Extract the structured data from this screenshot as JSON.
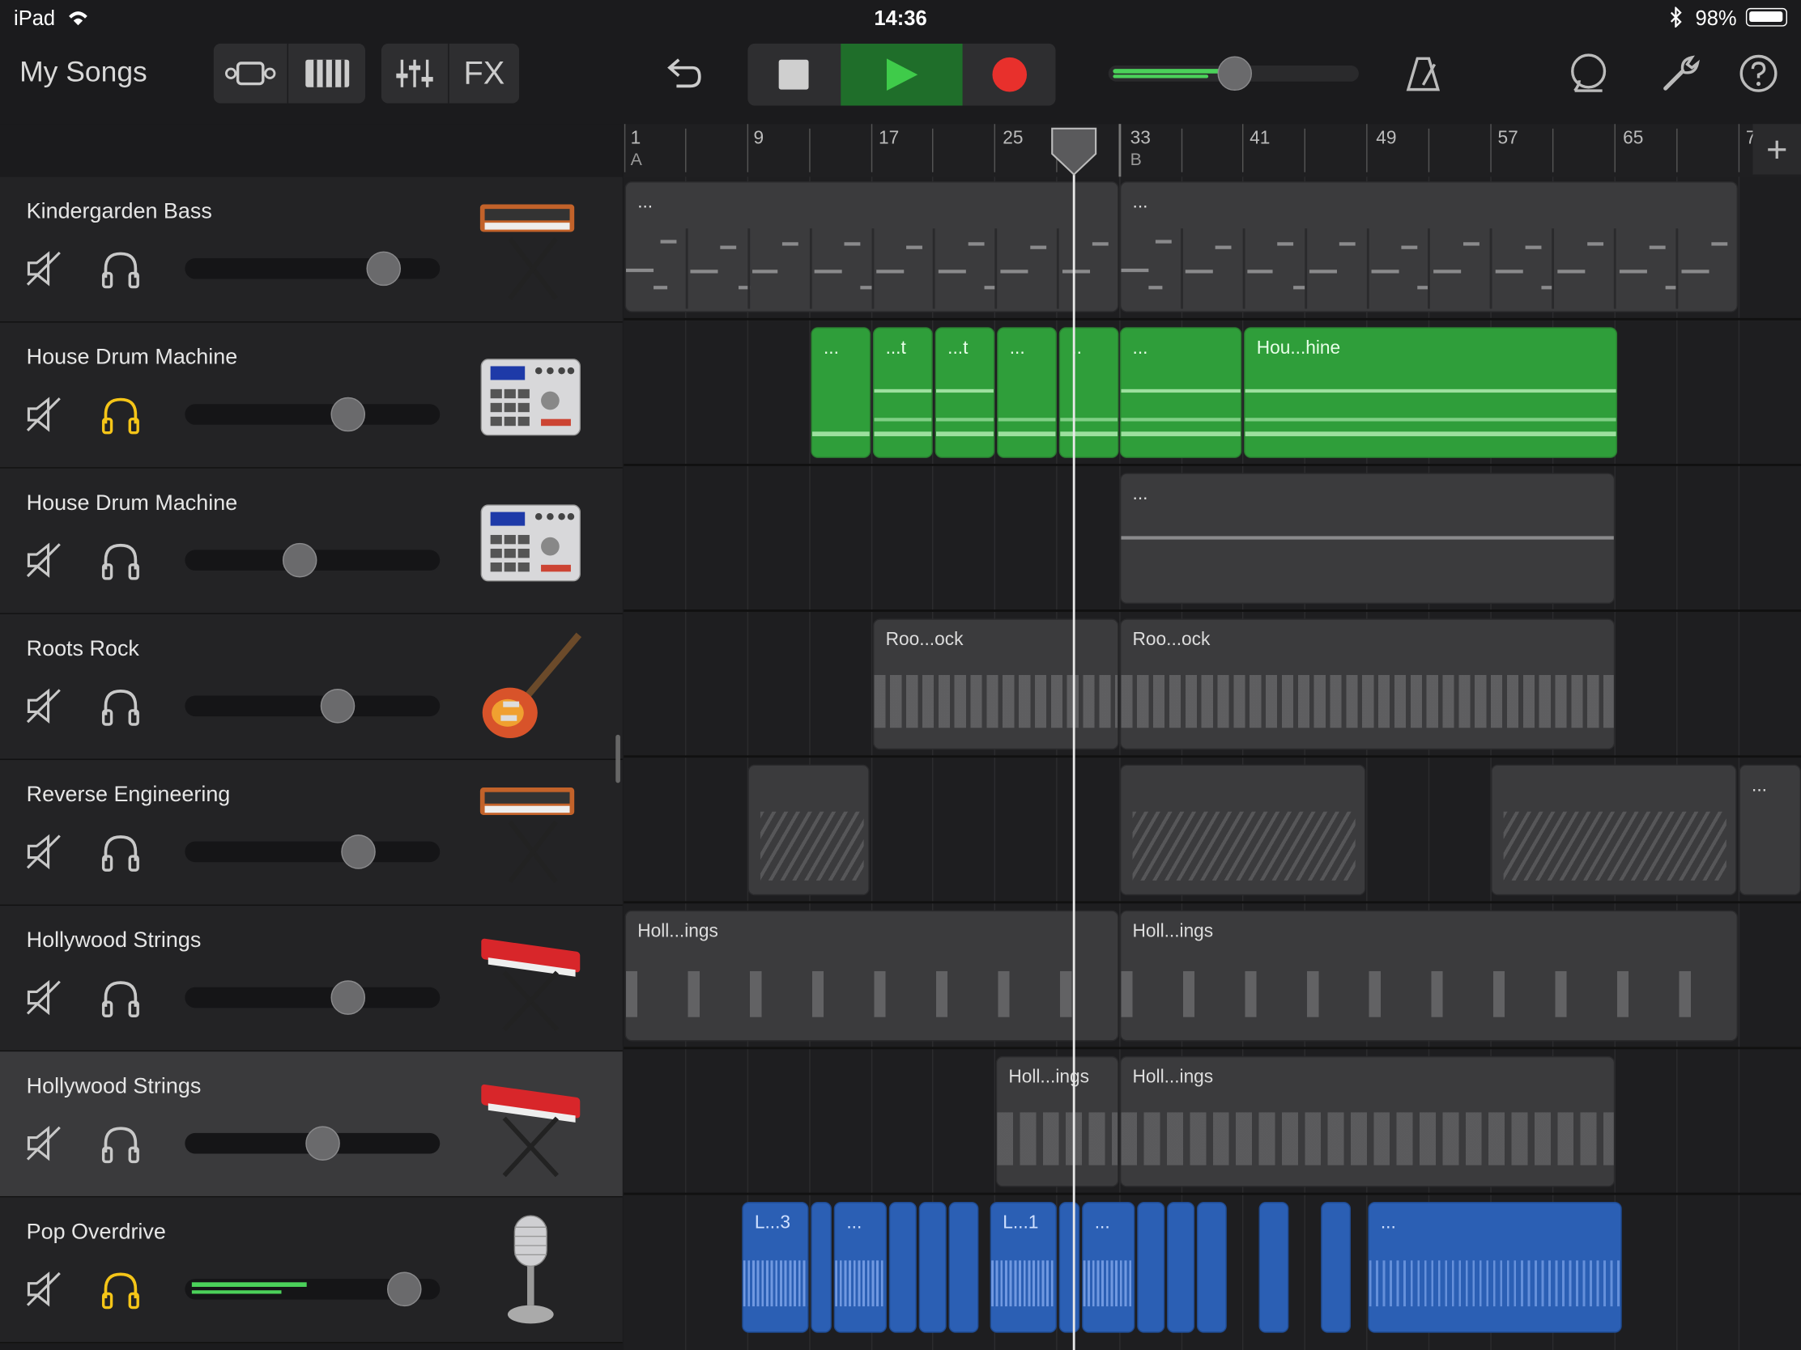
{
  "status": {
    "device": "iPad",
    "time": "14:36",
    "battery": "98%"
  },
  "toolbar": {
    "my_songs": "My Songs",
    "fx": "FX",
    "colors": {
      "play_bg": "#1f6e2a",
      "play_icon": "#3fcb4a",
      "record": "#e8302c",
      "accent_yellow": "#f5c518",
      "green": "#2f9e3a",
      "blue": "#2b5fb4"
    },
    "icons": [
      "tracks-view-icon",
      "keyboard-icon",
      "mixer-icon",
      "undo-icon",
      "stop-icon",
      "play-icon",
      "record-icon",
      "metronome-icon",
      "loop-browser-icon",
      "settings-wrench-icon",
      "help-icon"
    ],
    "master_volume": 0.55
  },
  "ruler": {
    "bars": [
      "1",
      "9",
      "17",
      "25",
      "33",
      "41",
      "49",
      "57",
      "65",
      "7"
    ],
    "sections": [
      "A",
      "B"
    ],
    "add_label": "+"
  },
  "tracks": [
    {
      "name": "Kindergarden Bass",
      "volume": 0.78,
      "solo": false,
      "instrument_icon": "synth-keyboard-icon"
    },
    {
      "name": "House Drum Machine",
      "volume": 0.64,
      "solo": true,
      "instrument_icon": "drum-machine-icon"
    },
    {
      "name": "House Drum Machine",
      "volume": 0.45,
      "solo": false,
      "instrument_icon": "drum-machine-icon"
    },
    {
      "name": "Roots Rock",
      "volume": 0.6,
      "solo": false,
      "instrument_icon": "electric-guitar-icon"
    },
    {
      "name": "Reverse Engineering",
      "volume": 0.68,
      "solo": false,
      "instrument_icon": "synth-keyboard-icon"
    },
    {
      "name": "Hollywood Strings",
      "volume": 0.64,
      "solo": false,
      "instrument_icon": "red-keyboard-icon"
    },
    {
      "name": "Hollywood Strings",
      "volume": 0.54,
      "solo": false,
      "instrument_icon": "red-keyboard-icon",
      "selected": true
    },
    {
      "name": "Pop Overdrive",
      "volume": 0.86,
      "solo": true,
      "instrument_icon": "microphone-icon",
      "level": 0.45
    }
  ],
  "region_labels": {
    "r0a": "...",
    "r0b": "...",
    "r1a": "...",
    "r1b": "...t",
    "r1c": "...t",
    "r1d": "...",
    "r1e": "..",
    "r1f": "...",
    "r1g": "Hou...hine",
    "r2a": "...",
    "r3a": "Roo...ock",
    "r3b": "Roo...ock",
    "r4a": "...",
    "r5a": "Holl...ings",
    "r5b": "Holl...ings",
    "r6a": "Holl...ings",
    "r6b": "Holl...ings",
    "r7a": "L...3",
    "r7b": "...",
    "r7c": "L...1",
    "r7d": "...",
    "r7e": "..."
  }
}
